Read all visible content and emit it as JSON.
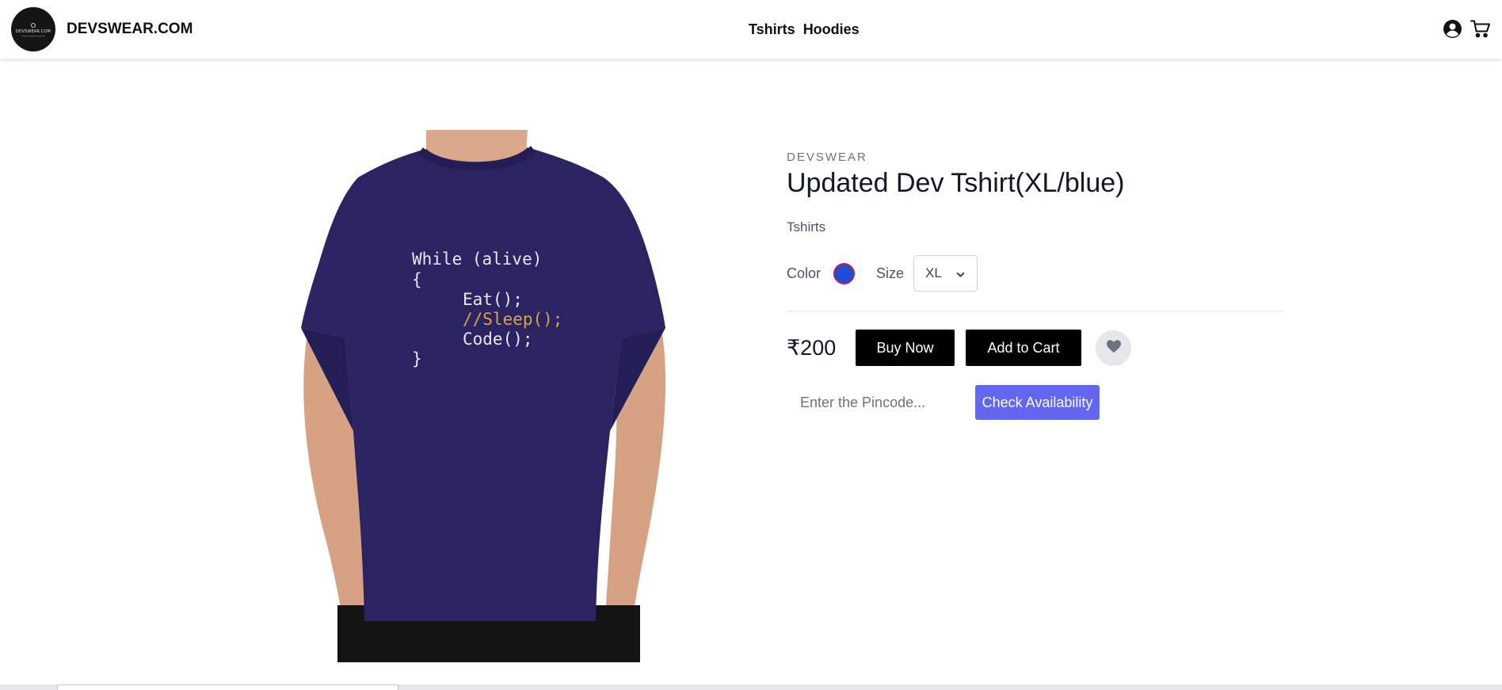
{
  "header": {
    "logo_text": "DEVSWEAR.COM",
    "brand": "DEVSWEAR.COM",
    "nav": [
      "Tshirts",
      "Hoodies"
    ],
    "icons": [
      "account-icon",
      "cart-icon"
    ]
  },
  "product": {
    "brand_label": "DEVSWEAR",
    "title": "Updated Dev Tshirt(XL/blue)",
    "category": "Tshirts",
    "color_label": "Color",
    "color_value": "#1d4ed8",
    "size_label": "Size",
    "size_value": "XL",
    "price": "₹200",
    "buy_now": "Buy Now",
    "add_to_cart": "Add to Cart",
    "image_code": [
      "While (alive)",
      "{",
      "Eat();",
      "//Sleep();",
      "Code();",
      "}"
    ]
  },
  "pincode": {
    "placeholder": "Enter the Pincode...",
    "check_button": "Check Availability"
  },
  "colors": {
    "accent": "#6366f1",
    "shirt": "#2a2463",
    "swatch": "#1d4ed8"
  }
}
